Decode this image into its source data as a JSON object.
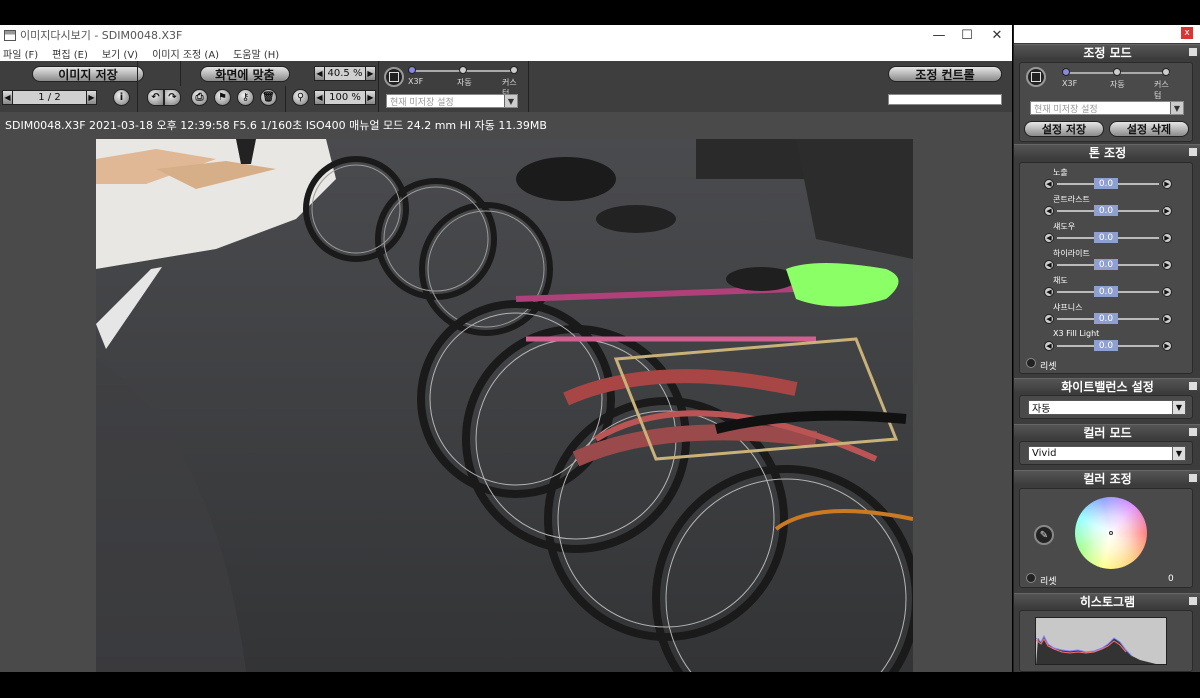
{
  "window": {
    "title": "이미지다시보기 - SDIM0048.X3F",
    "min": "—",
    "max": "☐",
    "close": "✕"
  },
  "menu": [
    "파일 (F)",
    "편집 (E)",
    "보기 (V)",
    "이미지 조정 (A)",
    "도움말 (H)"
  ],
  "toolbar": {
    "save_image": "이미지 저장",
    "fit_screen": "화면에 맞춤",
    "zoom_fit": "40.5 %",
    "zoom_100": "100 %",
    "page": "1 / 2",
    "info_btn": "i",
    "mode_x3f": "X3F",
    "mode_auto": "자동",
    "mode_custom": "커스텀",
    "current_settings": "현재 미저장 설정",
    "adjust_control": "조정 컨트롤",
    "active_mode_index": 0
  },
  "info_line": "SDIM0048.X3F 2021-03-18 오후 12:39:58 F5.6 1/160초 ISO400 매뉴얼 모드 24.2 mm HI 자동 11.39MB",
  "panel": {
    "close": "x",
    "adjust_mode": {
      "title": "조정 모드",
      "x3f": "X3F",
      "auto": "자동",
      "custom": "커스텀",
      "current": "현재 미저장 설정",
      "save": "설정 저장",
      "delete": "설정 삭제"
    },
    "tone": {
      "title": "톤 조정",
      "sliders": [
        {
          "label": "노출",
          "value": "0.0"
        },
        {
          "label": "콘트라스트",
          "value": "0.0"
        },
        {
          "label": "섀도우",
          "value": "0.0"
        },
        {
          "label": "하이라이트",
          "value": "0.0"
        },
        {
          "label": "채도",
          "value": "0.0"
        },
        {
          "label": "샤프니스",
          "value": "0.0"
        },
        {
          "label": "X3 Fill Light",
          "value": "0.0"
        }
      ],
      "reset": "리셋"
    },
    "wb": {
      "title": "화이트밸런스 설정",
      "value": "자동"
    },
    "color_mode": {
      "title": "컬러 모드",
      "value": "Vivid"
    },
    "color_adjust": {
      "title": "컬러 조정",
      "reset": "리셋",
      "value": "0"
    },
    "histogram": {
      "title": "히스토그램"
    }
  },
  "colors": {
    "window_bg": "#4a4a4a",
    "panel_bg": "#3c3c3c",
    "accent_value": "#8fa0d0"
  }
}
